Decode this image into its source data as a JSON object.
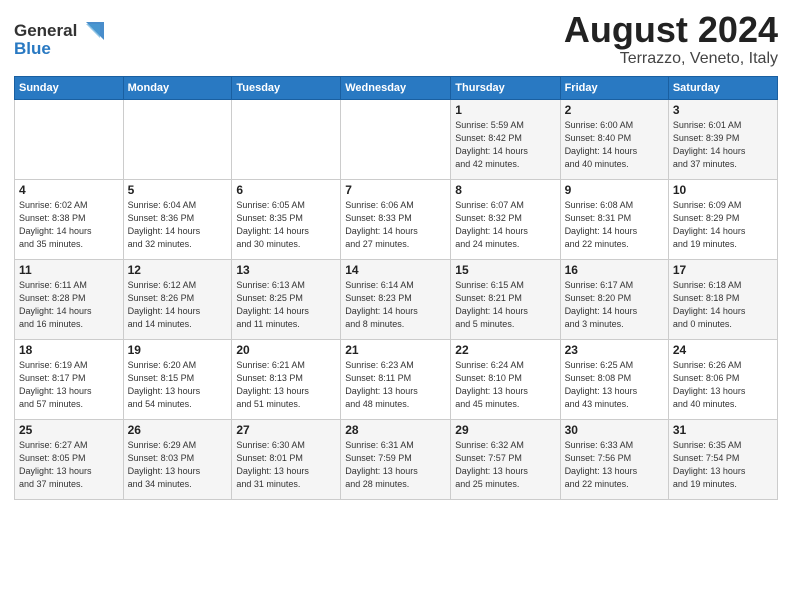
{
  "header": {
    "logo_line1": "General",
    "logo_line2": "Blue",
    "title": "August 2024",
    "subtitle": "Terrazzo, Veneto, Italy"
  },
  "weekdays": [
    "Sunday",
    "Monday",
    "Tuesday",
    "Wednesday",
    "Thursday",
    "Friday",
    "Saturday"
  ],
  "weeks": [
    [
      {
        "day": "",
        "info": ""
      },
      {
        "day": "",
        "info": ""
      },
      {
        "day": "",
        "info": ""
      },
      {
        "day": "",
        "info": ""
      },
      {
        "day": "1",
        "info": "Sunrise: 5:59 AM\nSunset: 8:42 PM\nDaylight: 14 hours\nand 42 minutes."
      },
      {
        "day": "2",
        "info": "Sunrise: 6:00 AM\nSunset: 8:40 PM\nDaylight: 14 hours\nand 40 minutes."
      },
      {
        "day": "3",
        "info": "Sunrise: 6:01 AM\nSunset: 8:39 PM\nDaylight: 14 hours\nand 37 minutes."
      }
    ],
    [
      {
        "day": "4",
        "info": "Sunrise: 6:02 AM\nSunset: 8:38 PM\nDaylight: 14 hours\nand 35 minutes."
      },
      {
        "day": "5",
        "info": "Sunrise: 6:04 AM\nSunset: 8:36 PM\nDaylight: 14 hours\nand 32 minutes."
      },
      {
        "day": "6",
        "info": "Sunrise: 6:05 AM\nSunset: 8:35 PM\nDaylight: 14 hours\nand 30 minutes."
      },
      {
        "day": "7",
        "info": "Sunrise: 6:06 AM\nSunset: 8:33 PM\nDaylight: 14 hours\nand 27 minutes."
      },
      {
        "day": "8",
        "info": "Sunrise: 6:07 AM\nSunset: 8:32 PM\nDaylight: 14 hours\nand 24 minutes."
      },
      {
        "day": "9",
        "info": "Sunrise: 6:08 AM\nSunset: 8:31 PM\nDaylight: 14 hours\nand 22 minutes."
      },
      {
        "day": "10",
        "info": "Sunrise: 6:09 AM\nSunset: 8:29 PM\nDaylight: 14 hours\nand 19 minutes."
      }
    ],
    [
      {
        "day": "11",
        "info": "Sunrise: 6:11 AM\nSunset: 8:28 PM\nDaylight: 14 hours\nand 16 minutes."
      },
      {
        "day": "12",
        "info": "Sunrise: 6:12 AM\nSunset: 8:26 PM\nDaylight: 14 hours\nand 14 minutes."
      },
      {
        "day": "13",
        "info": "Sunrise: 6:13 AM\nSunset: 8:25 PM\nDaylight: 14 hours\nand 11 minutes."
      },
      {
        "day": "14",
        "info": "Sunrise: 6:14 AM\nSunset: 8:23 PM\nDaylight: 14 hours\nand 8 minutes."
      },
      {
        "day": "15",
        "info": "Sunrise: 6:15 AM\nSunset: 8:21 PM\nDaylight: 14 hours\nand 5 minutes."
      },
      {
        "day": "16",
        "info": "Sunrise: 6:17 AM\nSunset: 8:20 PM\nDaylight: 14 hours\nand 3 minutes."
      },
      {
        "day": "17",
        "info": "Sunrise: 6:18 AM\nSunset: 8:18 PM\nDaylight: 14 hours\nand 0 minutes."
      }
    ],
    [
      {
        "day": "18",
        "info": "Sunrise: 6:19 AM\nSunset: 8:17 PM\nDaylight: 13 hours\nand 57 minutes."
      },
      {
        "day": "19",
        "info": "Sunrise: 6:20 AM\nSunset: 8:15 PM\nDaylight: 13 hours\nand 54 minutes."
      },
      {
        "day": "20",
        "info": "Sunrise: 6:21 AM\nSunset: 8:13 PM\nDaylight: 13 hours\nand 51 minutes."
      },
      {
        "day": "21",
        "info": "Sunrise: 6:23 AM\nSunset: 8:11 PM\nDaylight: 13 hours\nand 48 minutes."
      },
      {
        "day": "22",
        "info": "Sunrise: 6:24 AM\nSunset: 8:10 PM\nDaylight: 13 hours\nand 45 minutes."
      },
      {
        "day": "23",
        "info": "Sunrise: 6:25 AM\nSunset: 8:08 PM\nDaylight: 13 hours\nand 43 minutes."
      },
      {
        "day": "24",
        "info": "Sunrise: 6:26 AM\nSunset: 8:06 PM\nDaylight: 13 hours\nand 40 minutes."
      }
    ],
    [
      {
        "day": "25",
        "info": "Sunrise: 6:27 AM\nSunset: 8:05 PM\nDaylight: 13 hours\nand 37 minutes."
      },
      {
        "day": "26",
        "info": "Sunrise: 6:29 AM\nSunset: 8:03 PM\nDaylight: 13 hours\nand 34 minutes."
      },
      {
        "day": "27",
        "info": "Sunrise: 6:30 AM\nSunset: 8:01 PM\nDaylight: 13 hours\nand 31 minutes."
      },
      {
        "day": "28",
        "info": "Sunrise: 6:31 AM\nSunset: 7:59 PM\nDaylight: 13 hours\nand 28 minutes."
      },
      {
        "day": "29",
        "info": "Sunrise: 6:32 AM\nSunset: 7:57 PM\nDaylight: 13 hours\nand 25 minutes."
      },
      {
        "day": "30",
        "info": "Sunrise: 6:33 AM\nSunset: 7:56 PM\nDaylight: 13 hours\nand 22 minutes."
      },
      {
        "day": "31",
        "info": "Sunrise: 6:35 AM\nSunset: 7:54 PM\nDaylight: 13 hours\nand 19 minutes."
      }
    ]
  ]
}
